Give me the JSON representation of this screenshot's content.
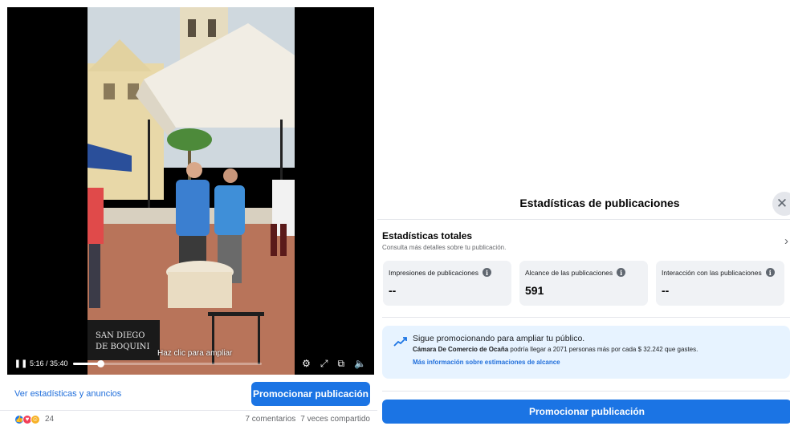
{
  "video": {
    "overlay_text": "Haz clic para ampliar",
    "time": "5:16 / 35:40",
    "progress": 0.148,
    "sign_text": "SAN DIEGO\nDE BOQUINI"
  },
  "post_actions": {
    "stats_link": "Ver estadísticas y anuncios",
    "promote_button": "Promocionar publicación"
  },
  "post_footer": {
    "reaction_count": "24",
    "comments": "7 comentarios",
    "shares": "7 veces compartido"
  },
  "panel": {
    "title": "Estadísticas de publicaciones",
    "totals": {
      "title": "Estadísticas totales",
      "subtitle": "Consulta más detalles sobre tu publicación."
    },
    "metrics": [
      {
        "label": "Impresiones de publicaciones",
        "value": "--"
      },
      {
        "label": "Alcance de las publicaciones",
        "value": "591"
      },
      {
        "label": "Interacción con las publicaciones",
        "value": "--"
      }
    ],
    "promo": {
      "title": "Sigue promocionando para ampliar tu público.",
      "page_name": "Cámara De Comercio de Ocaña",
      "body": " podría llegar a 2071 personas más por cada $ 32.242 que gastes.",
      "link": "Más información sobre estimaciones de alcance"
    },
    "promote_button": "Promocionar publicación"
  },
  "colors": {
    "accent": "#1b74e4",
    "link": "#216fdb",
    "card_bg": "#f0f2f5",
    "promo_bg": "#e7f3ff"
  }
}
